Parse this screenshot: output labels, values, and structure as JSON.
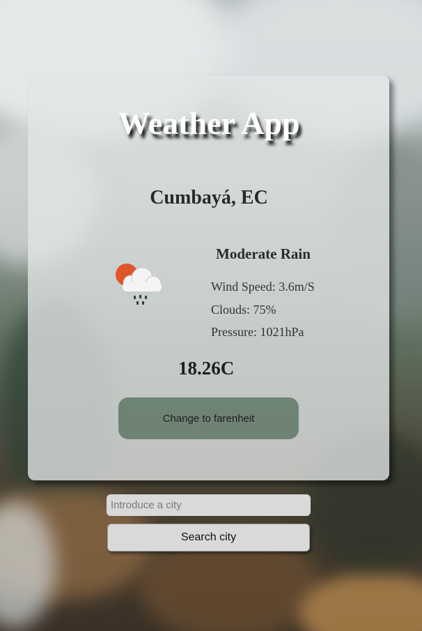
{
  "app": {
    "title": "Weather App"
  },
  "location": {
    "city": "Cumbayá, EC"
  },
  "weather": {
    "condition": "Moderate Rain",
    "icon": "sun-cloud-rain-icon",
    "wind_speed": "Wind Speed: 3.6m/S",
    "clouds": "Clouds: 75%",
    "pressure": "Pressure: 1021hPa",
    "temperature": "18.26C"
  },
  "controls": {
    "unit_toggle_label": "Change to farenheit",
    "search_placeholder": "Introduce a city",
    "search_value": "",
    "search_button_label": "Search city"
  },
  "colors": {
    "card_background": "#e2e5e6",
    "unit_button": "#3a5a44",
    "input_background": "#d9d9d9",
    "sun": "#e0552a"
  }
}
